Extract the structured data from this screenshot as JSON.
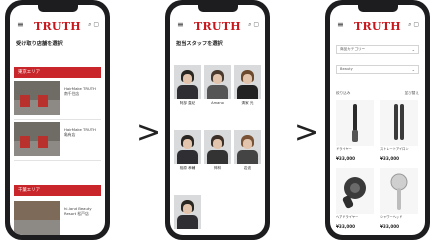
{
  "chevrons": [
    ">",
    ">"
  ],
  "header": {
    "logo": "TRUTH",
    "menu_icon": "≡",
    "icons": "⌕ ▢"
  },
  "screen1": {
    "title": "受け取り店舗を選択",
    "regions": [
      "東京エリア",
      "千葉エリア"
    ],
    "stores": [
      {
        "name": "HairMake TRUTH",
        "sub": "南千住店"
      },
      {
        "name": "HairMake TRUTH",
        "sub": "亀有店"
      },
      {
        "name": "HairMake TRUTH",
        "sub": "北千住店"
      },
      {
        "name": "hi-land Beauty",
        "sub": "Resort 松戸店"
      }
    ]
  },
  "screen2": {
    "title": "担当スタッフを選択",
    "staff": [
      "阿部 直紀",
      "Amano",
      "清家 光",
      "相原 孝輔",
      "神林",
      "岩波",
      "秋山",
      "先本"
    ]
  },
  "screen3": {
    "selects": [
      "商品カテゴリー",
      "Beauty"
    ],
    "filter": "絞り込み",
    "sort": "並び替え",
    "products": [
      {
        "name": "ドライヤー",
        "price": "¥33,000"
      },
      {
        "name": "ストレートアイロン",
        "price": "¥33,000"
      },
      {
        "name": "ヘアドライヤー",
        "price": "¥33,000"
      },
      {
        "name": "シャワーヘッド",
        "price": "¥33,000"
      }
    ]
  }
}
